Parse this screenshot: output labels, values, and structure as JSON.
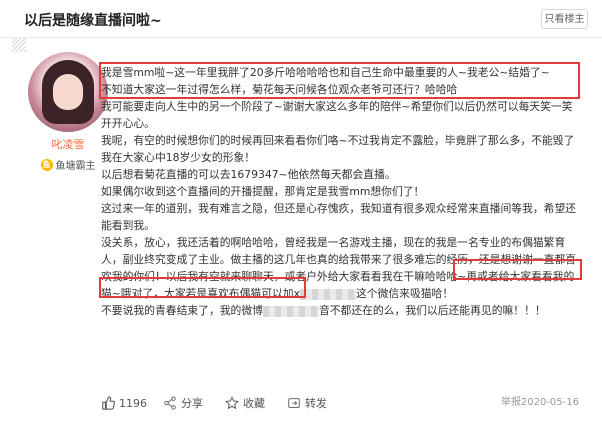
{
  "header": {
    "title": "以后是随缘直播间啦~",
    "only_author_button": "只看楼主"
  },
  "user": {
    "name": "叱凌雪",
    "badge_label": "鱼塘霸主"
  },
  "post": {
    "p1": "我是雪mm啦~这一年里我胖了20多斤哈哈哈哈也和自己生命中最重要的人~我老公~结婚了~",
    "p2": "不知道大家这一年过得怎么样，菊花每天问候各位观众老爷可还行？哈哈哈",
    "p3": "我可能要走向人生中的另一个阶段了~谢谢大家这么多年的陪伴~希望你们以后仍然可以每天笑一笑开开心心。",
    "p4": "我呢，有空的时候想你们的时候再回来看看你们咯~不过我肯定不露脸，毕竟胖了那么多，不能毁了我在大家心中18岁少女的形象！",
    "p5": "以后想看菊花直播的可以去1679347~他依然每天都会直播。",
    "p6": "如果偶尔收到这个直播间的开播提醒，那肯定是我雪mm想你们了！",
    "p7": "这过来一年的道别，我有难言之隐，但还是心存愧疚，我知道有很多观众经常来直播间等我，希望还能看到我。",
    "p8a": "没关系，放心，我还活着的啊哈哈哈，曾经我是一名游戏主播，",
    "p8b": "现在的我是一名专业的布偶猫繁育人，副业终究变成了主业",
    "p8c": "。做主播的这几年也真的给我带来了很多难忘的经历，还是想谢谢一直都喜欢我的你们！以后我有空就来聊聊天，或者户外给大家看看我在干嘛哈哈哈~再或者给大家看看我的猫~哦对了，大家若是喜欢布偶猫可以加",
    "p8d": "这个微信来吸猫哈！",
    "p8e": "x",
    "p9a": "不要说我的青春结束了，我的微博",
    "p9b": "音不都还在的么，我们以后还能再见的嘛！！！"
  },
  "footer": {
    "like_count": "1196",
    "share_label": "分享",
    "collect_label": "收藏",
    "forward_label": "转发",
    "report_label": "举报",
    "date": "2020-05-16"
  },
  "colors": {
    "highlight_border": "#e23b3b",
    "username": "#ff6a3d"
  },
  "icons": [
    "quote-mark-icon",
    "fish-badge-icon",
    "like-icon",
    "share-icon",
    "collect-icon",
    "forward-icon"
  ]
}
